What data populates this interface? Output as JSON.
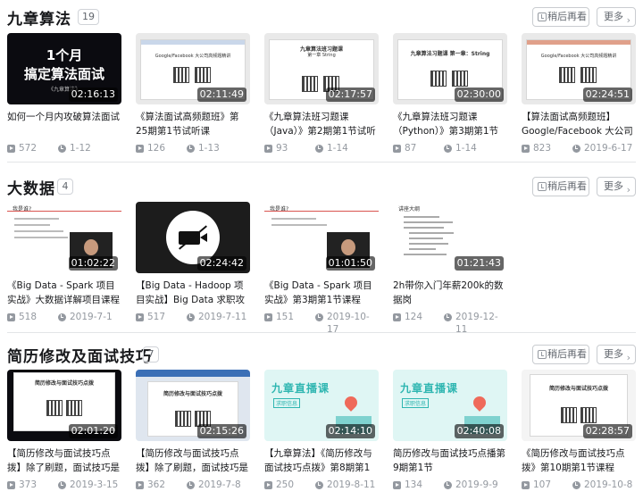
{
  "sections": [
    {
      "title": "九章算法",
      "count": "19",
      "watch_later_label": "稍后再看",
      "more_label": "更多",
      "videos": [
        {
          "title": "如何一个月内攻破算法面试",
          "duration": "02:16:13",
          "plays": "572",
          "date": "1-12",
          "thumb_text": "1个月",
          "thumb_text2": "搞定算法面试",
          "thumb_text3": "《九章算法》"
        },
        {
          "title": "《算法面试高频题班》第25期第1节试听课",
          "duration": "02:11:49",
          "plays": "126",
          "date": "1-13",
          "thumb_text": "Google/Facebook 大公司高频题精讲"
        },
        {
          "title": "《九章算法班习题课（Java）》第2期第1节试听",
          "duration": "02:17:57",
          "plays": "93",
          "date": "1-14",
          "thumb_text": "九章算法班习题课",
          "thumb_text2": "第一章 String"
        },
        {
          "title": "《九章算法班习题课（Python）》第3期第1节",
          "duration": "02:30:00",
          "plays": "87",
          "date": "1-14",
          "thumb_text": "九章算法习题课 第一章：String"
        },
        {
          "title": "【算法面试高频题班】Google/Facebook 大公司高",
          "duration": "02:24:51",
          "plays": "823",
          "date": "2019-6-17",
          "thumb_text": "Google/Facebook 大公司高频题精讲"
        }
      ]
    },
    {
      "title": "大数据",
      "count": "4",
      "watch_later_label": "稍后再看",
      "more_label": "更多",
      "videos": [
        {
          "title": "《Big Data - Spark 项目实战》大数据详解项目课程介",
          "duration": "01:02:22",
          "plays": "518",
          "date": "2019-7-1",
          "thumb_text": "我是谁?"
        },
        {
          "title": "【Big Data - Hadoop 项目实战】Big Data 求职攻略 &",
          "duration": "02:24:42",
          "plays": "517",
          "date": "2019-7-11"
        },
        {
          "title": "《Big Data - Spark 项目实战》第3期第1节课程",
          "duration": "01:01:50",
          "plays": "151",
          "date": "2019-10-17",
          "thumb_text": "我是谁?"
        },
        {
          "title": "2h带你入门年薪200k的数据岗",
          "duration": "01:21:43",
          "plays": "124",
          "date": "2019-12-11",
          "thumb_text": "讲座大纲"
        }
      ]
    },
    {
      "title": "简历修改及面试技巧",
      "count": "7",
      "watch_later_label": "稍后再看",
      "more_label": "更多",
      "videos": [
        {
          "title": "【简历修改与面试技巧点拨】除了刷题，面试技巧是拿到",
          "duration": "02:01:20",
          "plays": "373",
          "date": "2019-3-15",
          "thumb_text": "简历修改与面试技巧点拨"
        },
        {
          "title": "【简历修改与面试技巧点拨】除了刷题，面试技巧是拿到",
          "duration": "02:15:26",
          "plays": "362",
          "date": "2019-7-8",
          "thumb_text": "简历修改与面试技巧点拨"
        },
        {
          "title": "【九章算法】《简历修改与面试技巧点拨》第8期第1节课程",
          "duration": "02:14:10",
          "plays": "250",
          "date": "2019-8-11",
          "thumb_text": "九章直播课",
          "thumb_text2": "求职信息"
        },
        {
          "title": "简历修改与面试技巧点播第9期第1节",
          "duration": "02:40:08",
          "plays": "134",
          "date": "2019-9-9",
          "thumb_text": "九章直播课",
          "thumb_text2": "求职信息"
        },
        {
          "title": "《简历修改与面试技巧点拨》第10期第1节课程",
          "duration": "02:28:57",
          "plays": "107",
          "date": "2019-10-8",
          "thumb_text": "简历修改与面试技巧点拨"
        }
      ]
    }
  ],
  "icons": {
    "watch_later": "clock-icon",
    "more": "chevron-right-icon",
    "plays": "play-icon",
    "date": "clock-icon"
  }
}
